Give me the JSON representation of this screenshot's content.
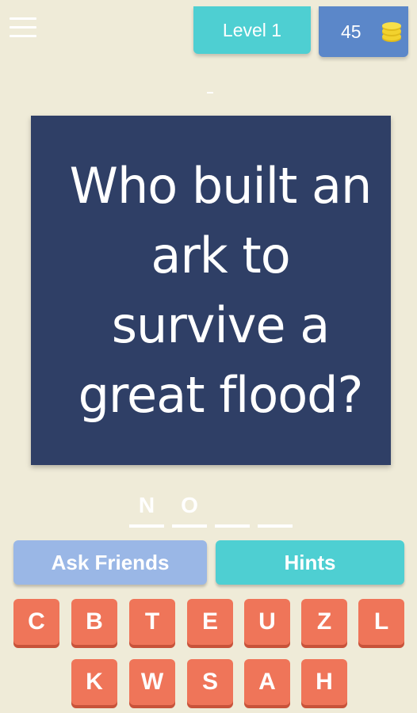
{
  "header": {
    "level_label": "Level 1",
    "coins": "45",
    "coin_icon": "coin-stack-icon",
    "coin_color": "#f2d22e"
  },
  "question": {
    "text": "Who built an ark to survive a great flood?"
  },
  "answer": {
    "slots": [
      "N",
      "O",
      "",
      ""
    ]
  },
  "actions": {
    "ask_friends_label": "Ask Friends",
    "hints_label": "Hints"
  },
  "keyboard": {
    "row1": [
      "C",
      "B",
      "T",
      "E",
      "U",
      "Z",
      "L"
    ],
    "row2": [
      "K",
      "W",
      "S",
      "A",
      "H"
    ]
  },
  "colors": {
    "background": "#efebd8",
    "card": "#2f3f66",
    "level_button": "#4ecfd2",
    "coins_box": "#5b87c9",
    "ask_friends": "#9ab7e6",
    "hints": "#4ecfd2",
    "key": "#ef7559"
  }
}
